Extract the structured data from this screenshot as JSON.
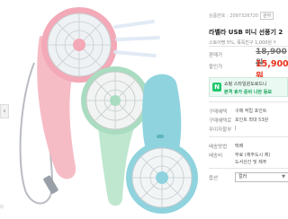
{
  "image_area": {
    "nav_left_icon": "chevron-left-icon",
    "brand_text": "Q"
  },
  "product": {
    "meta_text": "상품번호 : 2097326720",
    "meta_tag": "원하",
    "title": "라벨라 USB 미니 선풍기 2",
    "subtitle": "스토어명 5%, 폭죽친구 1,000원 Y",
    "price_label": "판매가",
    "original_price": "18,900원",
    "sale_label": "할인가",
    "sale_price": "15,900원"
  },
  "banner": {
    "icon": "shopping-window-icon",
    "icon_char": "N",
    "line1": "쇼핑 스타일윈도로드니",
    "line2": "본격 휴가 준비 나한 등보"
  },
  "specs": [
    {
      "label": "구매혜택",
      "value": "구매 적립 포인트"
    },
    {
      "label": "구매혜택로",
      "value": "포인트 최대 53원"
    },
    {
      "label": "무이자할부",
      "value": "|"
    },
    {
      "label": "배송방법",
      "value": "택배"
    },
    {
      "label": "배송비",
      "value": "무료 (제주도시 제)"
    },
    {
      "label": "",
      "value": "도서산간 및 제주"
    }
  ],
  "option": {
    "label": "옵션",
    "select_value": "컬러",
    "chevron_icon": "chevron-down-icon"
  },
  "colors": {
    "pink_fan": "#f6bcc6",
    "green_fan": "#bfe7cf",
    "blue_fan": "#8fd3de",
    "sale_red": "#e8311a",
    "banner_green": "#16a35a"
  }
}
